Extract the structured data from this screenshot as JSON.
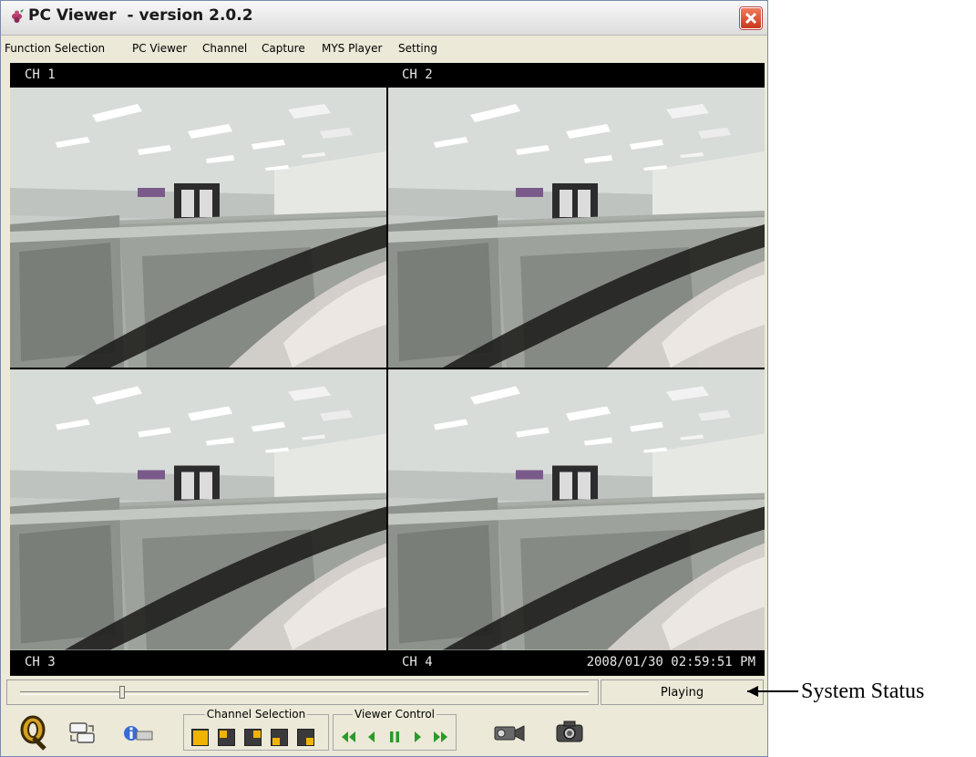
{
  "window": {
    "title": "PC Viewer  - version 2.0.2"
  },
  "menu": [
    "Function Selection",
    "PC Viewer",
    "Channel",
    "Capture",
    "MYS Player",
    "Setting"
  ],
  "channels": [
    {
      "label": "CH 1"
    },
    {
      "label": "CH 2"
    },
    {
      "label": "CH 3"
    },
    {
      "label": "CH 4"
    }
  ],
  "timestamp": "2008/01/30 02:59:51 PM",
  "playback": {
    "position": 0.18,
    "status": "Playing"
  },
  "toolbar": {
    "channel_selection_label": "Channel Selection",
    "viewer_control_label": "Viewer Control",
    "icons": [
      "logo-q-icon",
      "switch-icon",
      "info-icon",
      "record-icon",
      "snapshot-camera-icon"
    ],
    "channel_buttons": [
      "quad-view",
      "channel-1",
      "channel-2",
      "channel-3",
      "channel-4"
    ],
    "viewer_controls": [
      "rewind",
      "step-back",
      "pause",
      "play",
      "fast-forward"
    ]
  },
  "annotation": {
    "label": "System Status"
  },
  "colors": {
    "accent_green": "#2a9a2a",
    "channel_yellow": "#f0b400",
    "close_red": "#d44a28"
  }
}
